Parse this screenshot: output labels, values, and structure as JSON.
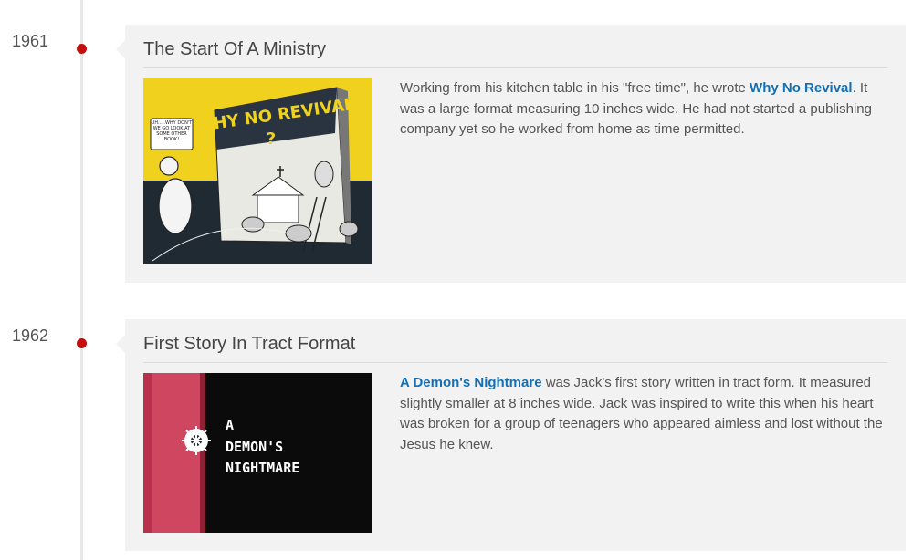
{
  "entries": [
    {
      "year": "1961",
      "title": "The Start Of A Ministry",
      "image": {
        "cover_title": "WHY NO REVIVAL",
        "cover_mark": "?",
        "speech_bubble": "UH.....WHY DON'T WE GO LOOK AT SOME OTHER BOOK!"
      },
      "text_before_link": "Working from his kitchen table in his \"free time\", he wrote ",
      "link_text": "Why No Revival",
      "text_after_link": ". It was a large format measuring 10 inches wide. He had not started a publishing company yet so he worked from home as time permitted."
    },
    {
      "year": "1962",
      "title": "First Story In Tract Format",
      "image": {
        "cover_title_line1": "A",
        "cover_title_line2": "DEMON'S",
        "cover_title_line3": "NIGHTMARE"
      },
      "text_before_link": "",
      "link_text": "A Demon's Nightmare",
      "text_after_link": " was Jack's first story written in tract form. It measured slightly smaller at 8 inches wide. Jack was inspired to write this when his heart was broken for a group of teenagers who appeared aimless and lost without the Jesus he knew."
    }
  ],
  "colors": {
    "dot": "#c40f0f",
    "link": "#1370b5",
    "card_bg": "#f2f2f2"
  }
}
